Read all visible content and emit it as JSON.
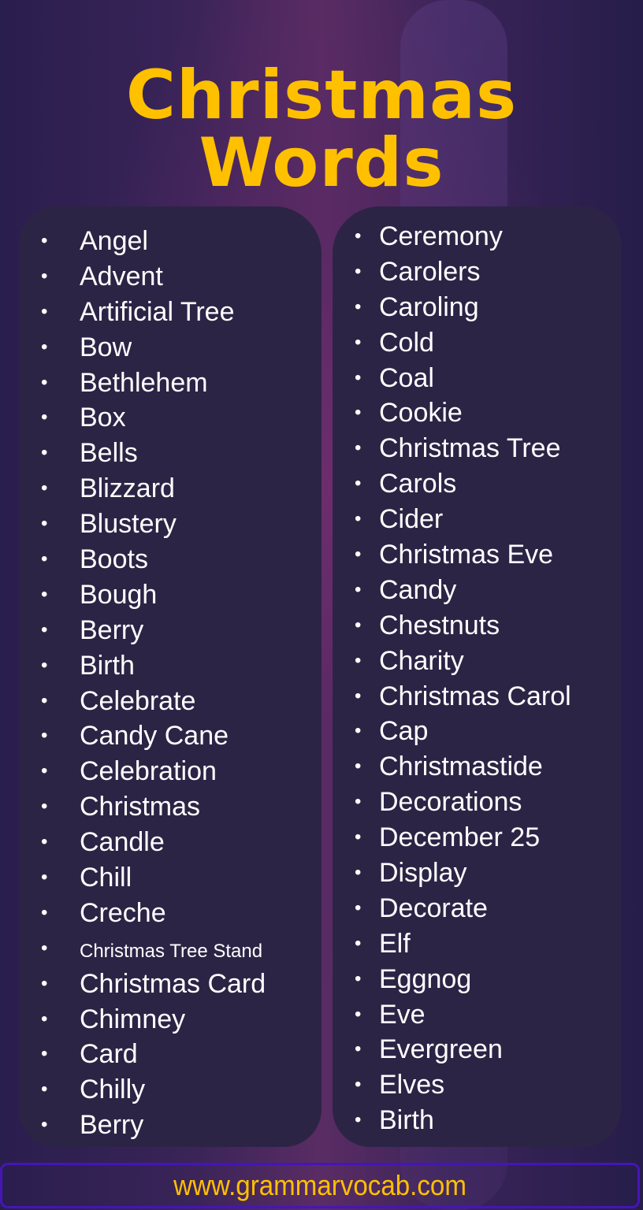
{
  "title": "Christmas Words",
  "colors": {
    "title": "#ffc000",
    "panel": "#2c2445",
    "text": "#ffffff",
    "footer_border": "#4515b8"
  },
  "bullet_icon": "•",
  "left_list": [
    "Angel",
    "Advent",
    "Artificial Tree",
    "Bow",
    "Bethlehem",
    "Box",
    "Bells",
    "Blizzard",
    "Blustery",
    "Boots",
    "Bough",
    "Berry",
    "Birth",
    "Celebrate",
    "Candy Cane",
    "Celebration",
    "Christmas",
    "Candle",
    "Chill",
    "Creche",
    "Christmas Tree Stand",
    "Christmas Card",
    "Chimney",
    "Card",
    "Chilly",
    "Berry"
  ],
  "right_list": [
    "Ceremony",
    "Carolers",
    "Caroling",
    "Cold",
    "Coal",
    "Cookie",
    "Christmas Tree",
    "Carols",
    "Cider",
    "Christmas Eve",
    "Candy",
    "Chestnuts",
    "Charity",
    "Christmas Carol",
    "Cap",
    "Christmastide",
    "Decorations",
    "December 25",
    "Display",
    "Decorate",
    "Elf",
    "Eggnog",
    "Eve",
    "Evergreen",
    "Elves",
    "Birth"
  ],
  "footer": {
    "url": "www.grammarvocab.com"
  }
}
